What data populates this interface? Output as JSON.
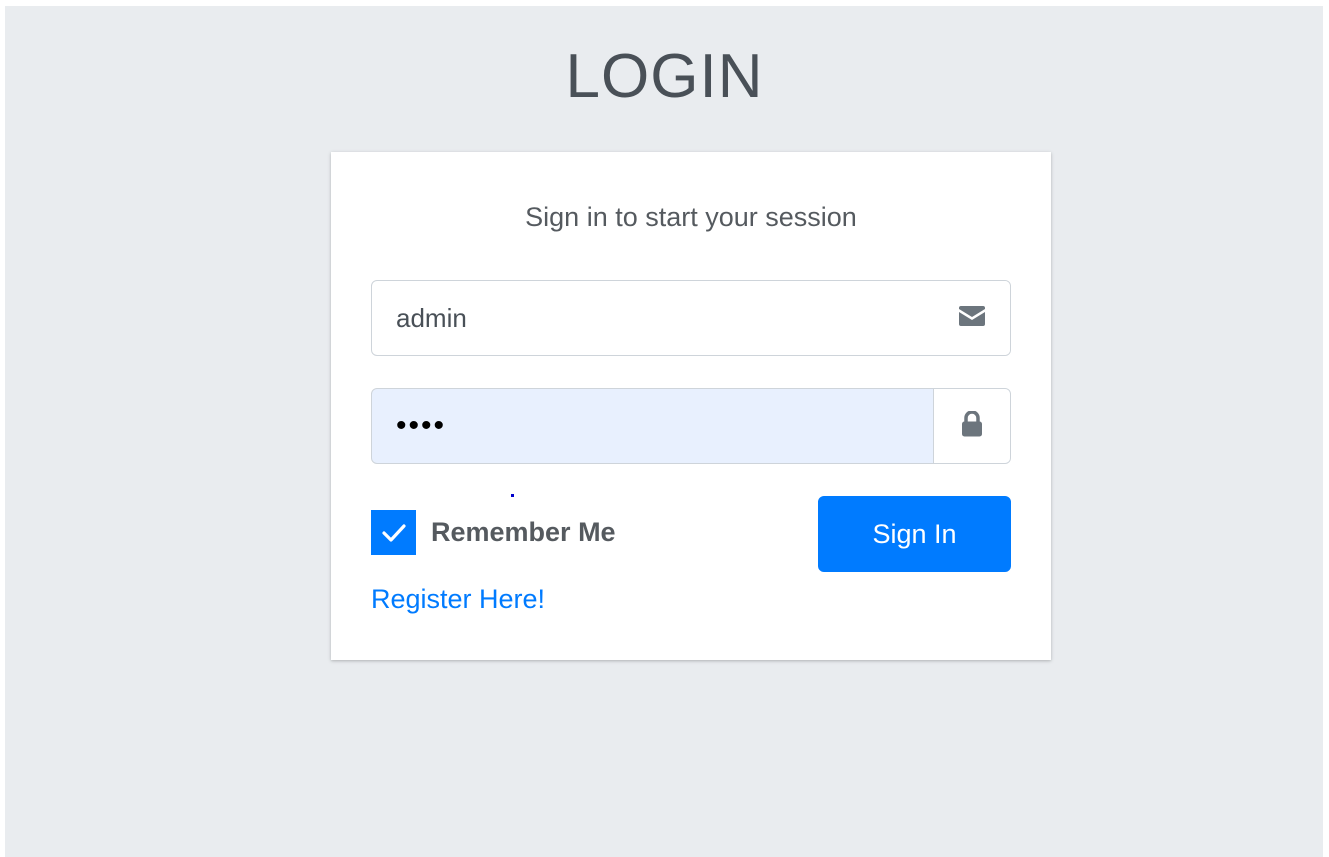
{
  "page": {
    "title": "LOGIN"
  },
  "card": {
    "message": "Sign in to start your session"
  },
  "form": {
    "username": {
      "value": "admin",
      "icon": "envelope-icon"
    },
    "password": {
      "value": "••••",
      "icon": "lock-icon"
    },
    "remember": {
      "label": "Remember Me",
      "checked": true
    },
    "submit_label": "Sign In",
    "register_label": "Register Here!"
  },
  "colors": {
    "background": "#e9ecef",
    "card": "#ffffff",
    "primary": "#007bff",
    "autofill": "#e8f0fe",
    "text": "#495057"
  }
}
